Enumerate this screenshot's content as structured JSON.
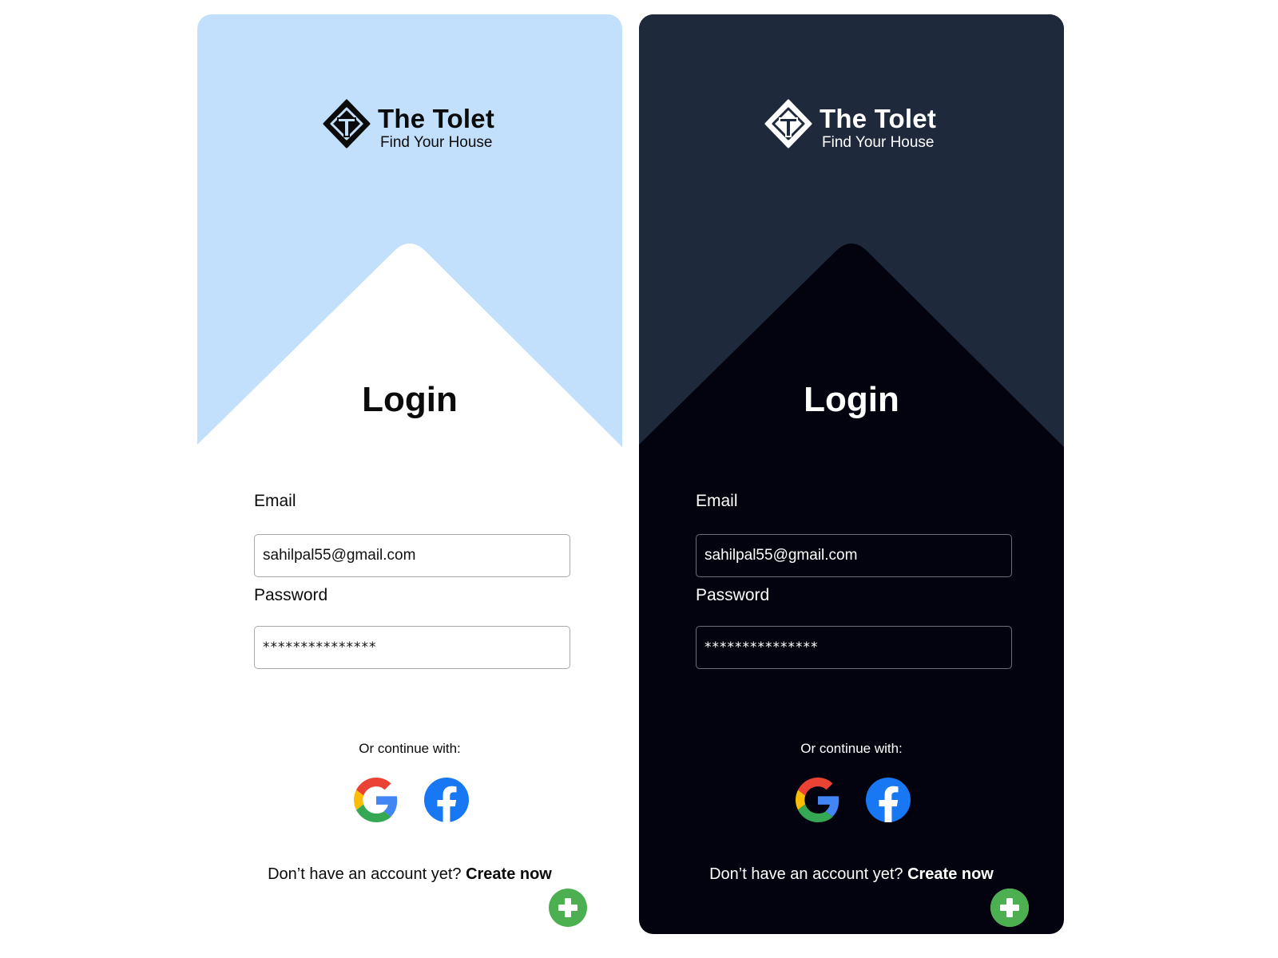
{
  "themes": {
    "light": {
      "header_bg": "#c2e0fc",
      "card_bg": "#ffffff",
      "text": "#0b0b0b"
    },
    "dark": {
      "header_bg": "#1e293b",
      "card_bg": "#02030f",
      "text": "#ffffff"
    }
  },
  "accent": {
    "fab_green": "#4caf50",
    "facebook_blue": "#1877f2"
  },
  "brand": {
    "name": "The Tolet",
    "tagline": "Find Your House",
    "logo": "house-diamond-logo-icon"
  },
  "login": {
    "title": "Login",
    "email_label": "Email",
    "email_value": "sahilpal55@gmail.com",
    "password_label": "Password",
    "password_value": "***************",
    "continue_text": "Or continue with:",
    "social": [
      "google-icon",
      "facebook-icon"
    ],
    "no_account_text": "Don’t have an account yet?",
    "create_link": "Create now",
    "fab_icon": "plus-icon"
  }
}
